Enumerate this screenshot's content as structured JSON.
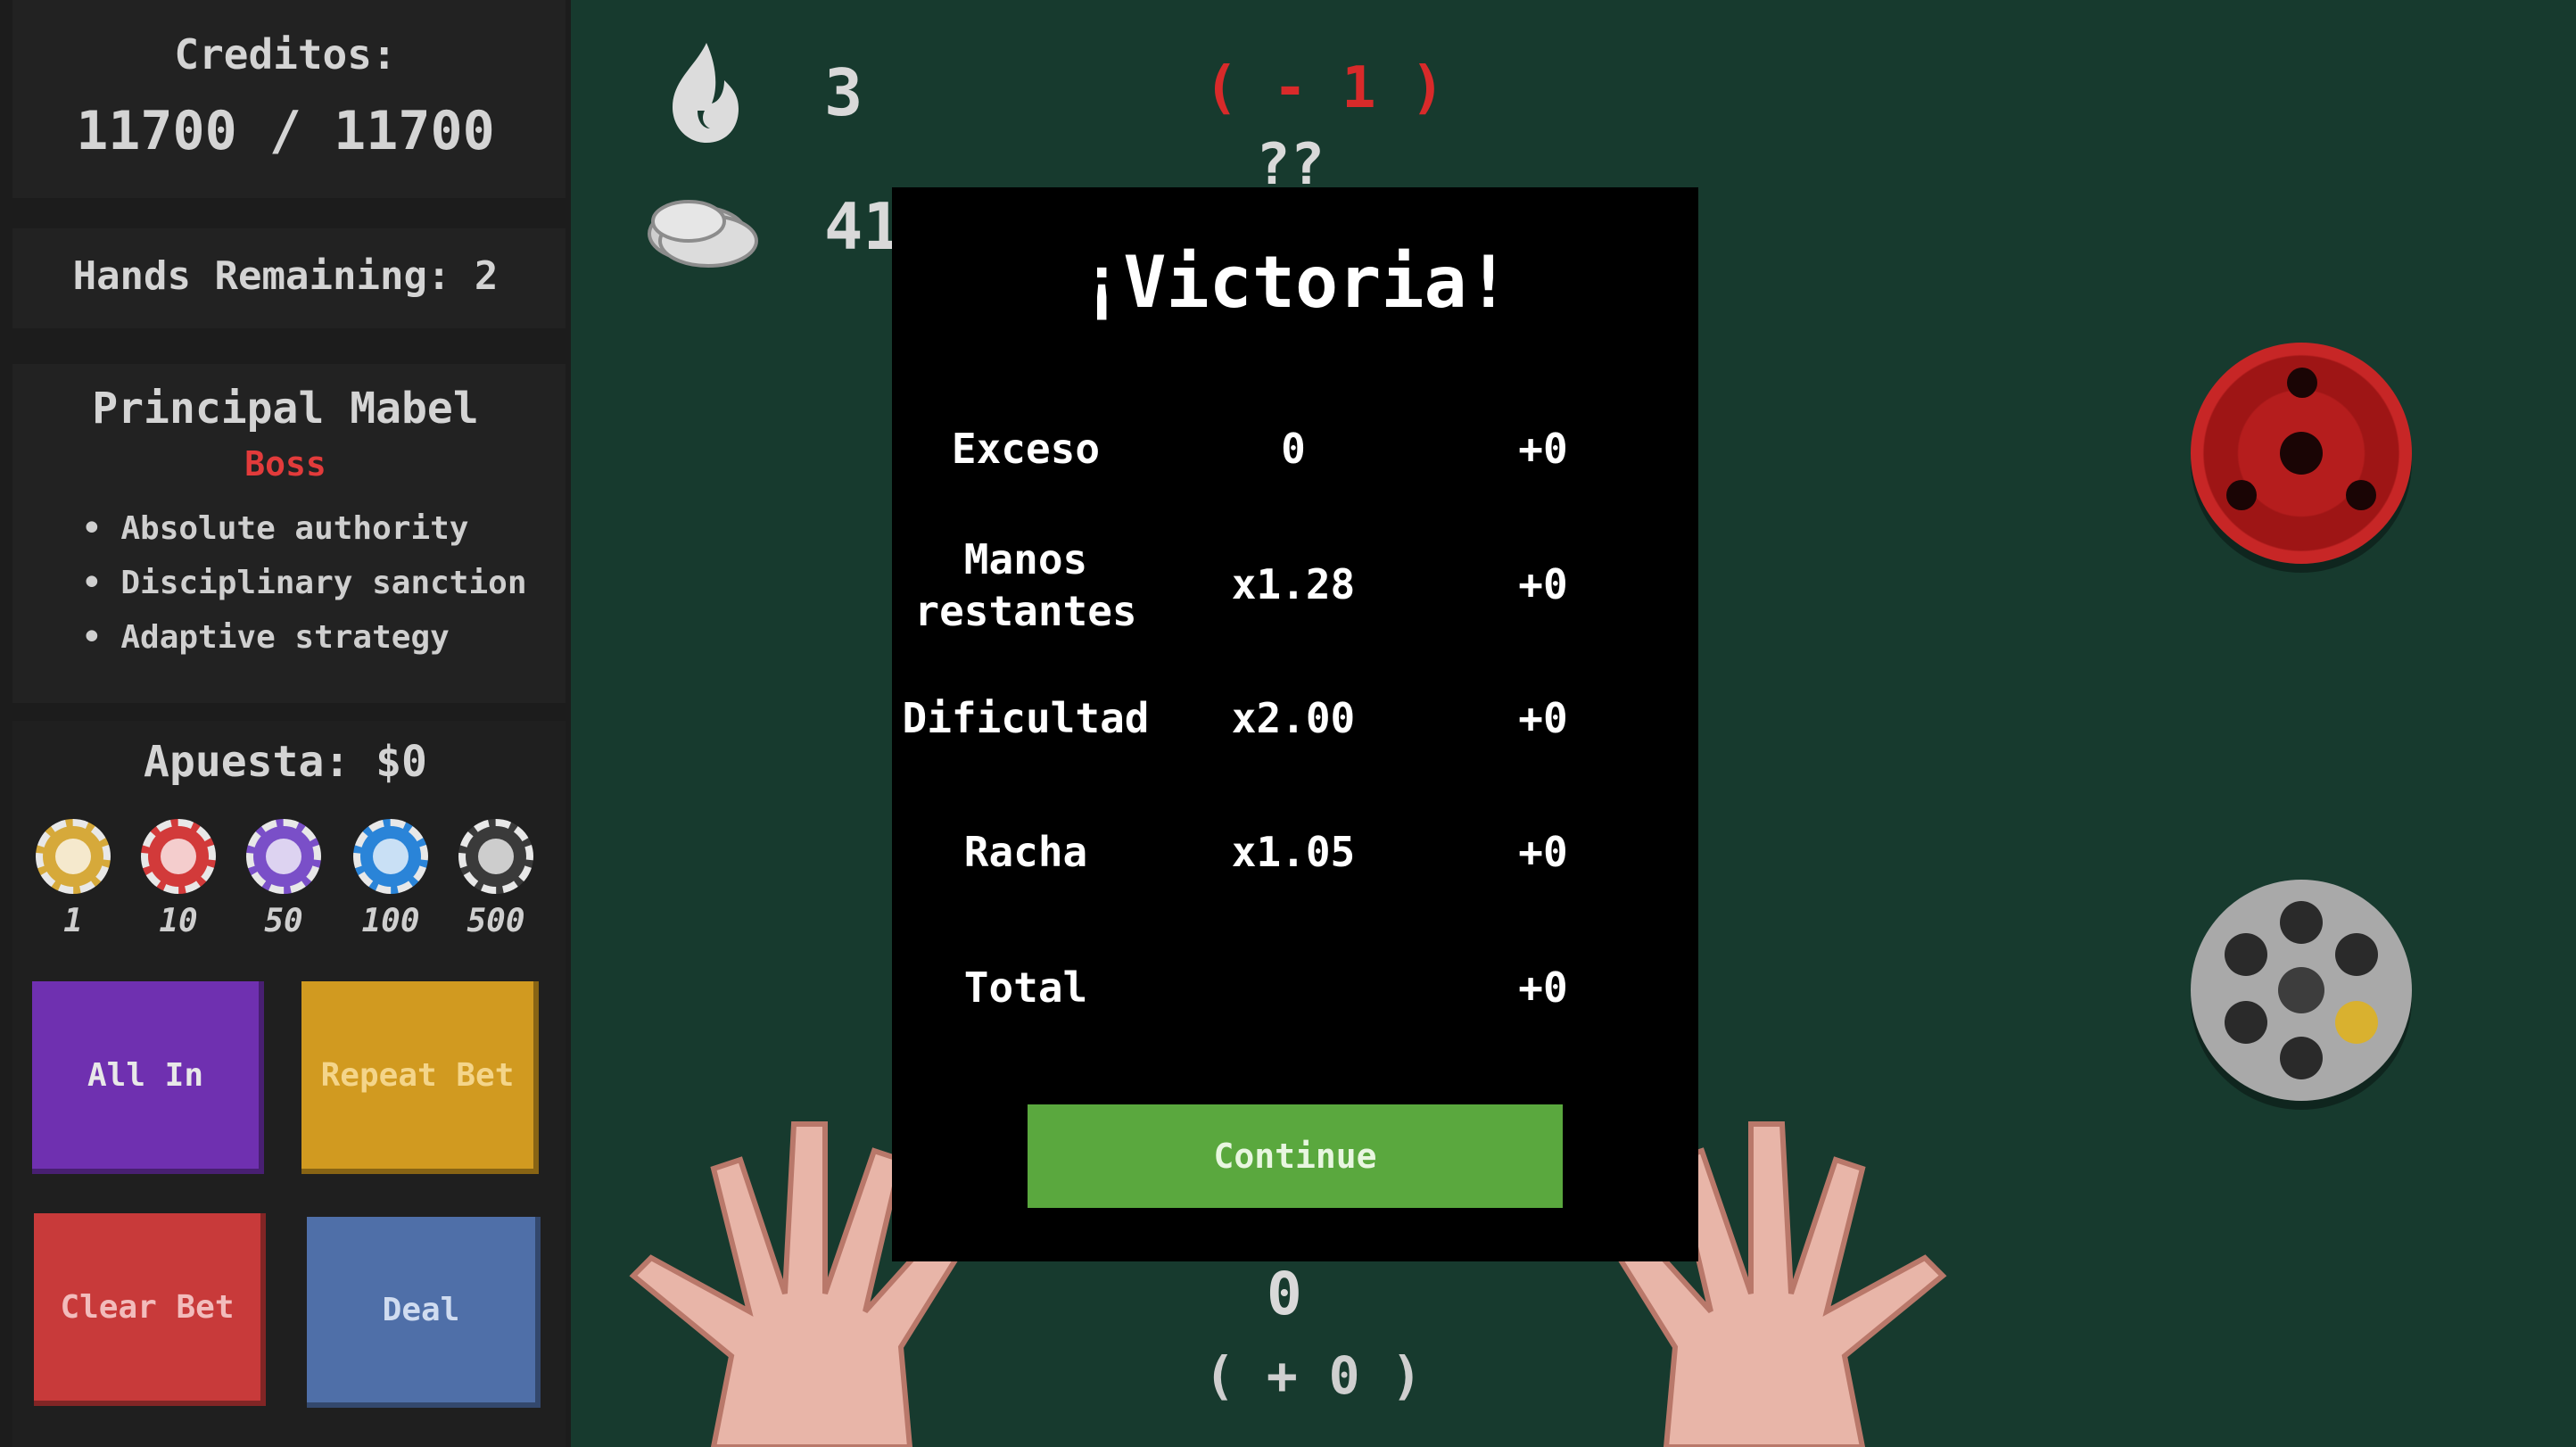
{
  "sidebar": {
    "credits_label": "Creditos:",
    "credits_value": "11700 / 11700",
    "hands_remaining": "Hands Remaining: 2",
    "boss": {
      "name": "Principal Mabel",
      "tag": "Boss",
      "traits": [
        "• Absolute authority",
        "• Disciplinary sanction",
        "• Adaptive strategy"
      ]
    },
    "bet_label": "Apuesta: $0",
    "chips": [
      {
        "label": "1",
        "color": "#d6a93a"
      },
      {
        "label": "10",
        "color": "#d23a3a"
      },
      {
        "label": "50",
        "color": "#7a4fc8"
      },
      {
        "label": "100",
        "color": "#2a84d8"
      },
      {
        "label": "500",
        "color": "#3a3a3a"
      }
    ],
    "buttons": {
      "all_in": "All In",
      "repeat_bet": "Repeat Bet",
      "clear_bet": "Clear Bet",
      "deal": "Deal"
    }
  },
  "table": {
    "streak_value": "3",
    "coins_value": "41",
    "penalty": "( - 1 )",
    "unknown": "??",
    "bottom_value": "0",
    "bottom_delta": "( + 0 )"
  },
  "modal": {
    "title": "¡Victoria!",
    "rows": [
      {
        "label": "Exceso",
        "mult": "0",
        "bonus": "+0"
      },
      {
        "label": "Manos restantes",
        "mult": "x1.28",
        "bonus": "+0"
      },
      {
        "label": "Dificultad",
        "mult": "x2.00",
        "bonus": "+0"
      },
      {
        "label": "Racha",
        "mult": "x1.05",
        "bonus": "+0"
      },
      {
        "label": "Total",
        "mult": "",
        "bonus": "+0"
      }
    ],
    "continue_label": "Continue"
  },
  "colors": {
    "felt": "#173a2e",
    "danger": "#d82a2a",
    "continue": "#5aa83e"
  }
}
